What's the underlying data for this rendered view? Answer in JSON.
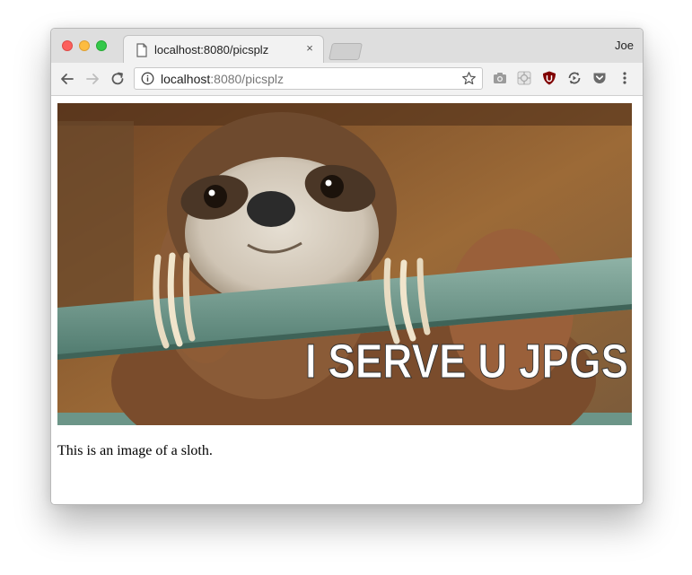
{
  "browser": {
    "tab_title": "localhost:8080/picsplz",
    "tab_close": "×",
    "profile_name": "Joe",
    "url_host": "localhost",
    "url_path": ":8080/picsplz"
  },
  "page": {
    "image_overlay_text": "I SERVE U JPGS",
    "caption": "This is an image of a sloth."
  },
  "icons": {
    "back": "arrow-left-icon",
    "forward": "arrow-right-icon",
    "reload": "reload-icon",
    "info": "info-icon",
    "bookmark": "star-icon",
    "extensions": [
      "camera-icon",
      "puzzle-icon",
      "ublock-shield-icon",
      "sync-icon",
      "pocket-icon"
    ],
    "menu": "more-vert-icon"
  },
  "colors": {
    "close": "#fc605c",
    "minimize": "#fdbc40",
    "maximize": "#34c84a"
  }
}
